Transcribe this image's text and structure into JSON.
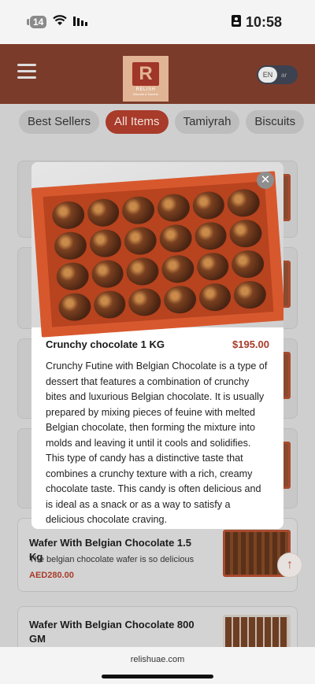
{
  "status": {
    "battery_level": "14",
    "time": "10:58"
  },
  "header": {
    "logo_text": "RELISH",
    "logo_sub": "Biscuits & Sweets",
    "lang_en": "EN",
    "lang_ar": "ar"
  },
  "tabs": [
    {
      "label": "Best Sellers",
      "active": false
    },
    {
      "label": "All Items",
      "active": true
    },
    {
      "label": "Tamiyrah",
      "active": false
    },
    {
      "label": "Biscuits",
      "active": false
    }
  ],
  "list": {
    "cards": [
      {
        "title": "Wafer With Belgian Chocolate 1.5 Kg",
        "desc": "The belgian chocolate wafer is so delicious",
        "price": "AED280.00"
      },
      {
        "title": "Wafer With Belgian Chocolate 800 GM"
      }
    ]
  },
  "modal": {
    "title": "Crunchy chocolate 1 KG",
    "price": "$195.00",
    "description": "Crunchy Futine with Belgian Chocolate is a type of dessert that features a combination of crunchy bites and luxurious Belgian chocolate. It is usually prepared by mixing pieces of feuine with melted Belgian chocolate, then forming the mixture into molds and leaving it until it cools and solidifies. This type of candy has a distinctive taste that combines a crunchy texture with a rich, creamy chocolate taste. This candy is often delicious and is ideal as a snack or as a way to satisfy a delicious chocolate craving.",
    "close_icon": "close-icon"
  },
  "browser": {
    "url": "relishuae.com"
  },
  "colors": {
    "brand": "#7b3b2a",
    "accent": "#a83b2a"
  }
}
